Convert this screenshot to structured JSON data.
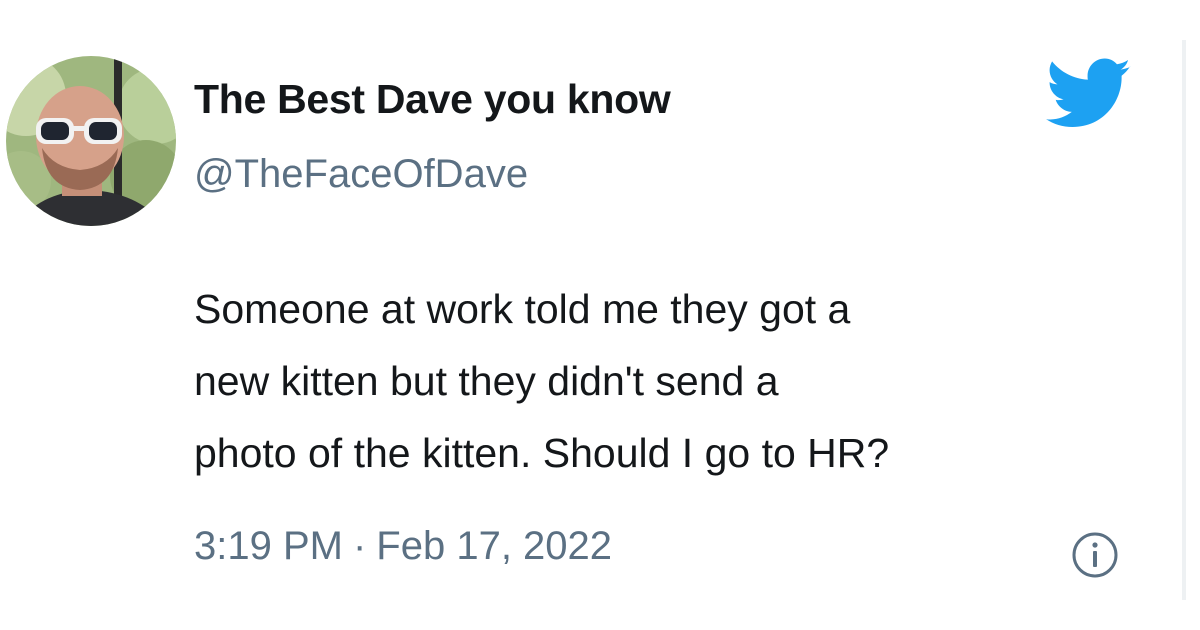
{
  "author": {
    "display_name": "The Best Dave you know",
    "handle": "@TheFaceOfDave"
  },
  "tweet": {
    "lines": [
      "Someone at work told me they got a",
      "new kitten but they didn't send a",
      "photo of the kitten. Should I go to HR?"
    ]
  },
  "meta": {
    "time": "3:19 PM",
    "separator": "·",
    "date": "Feb 17, 2022"
  },
  "icons": {
    "logo": "twitter-bird-icon",
    "info": "info-icon"
  },
  "colors": {
    "twitter_blue": "#1da1f2",
    "text_primary": "#14171a",
    "text_secondary": "#5b7083"
  }
}
